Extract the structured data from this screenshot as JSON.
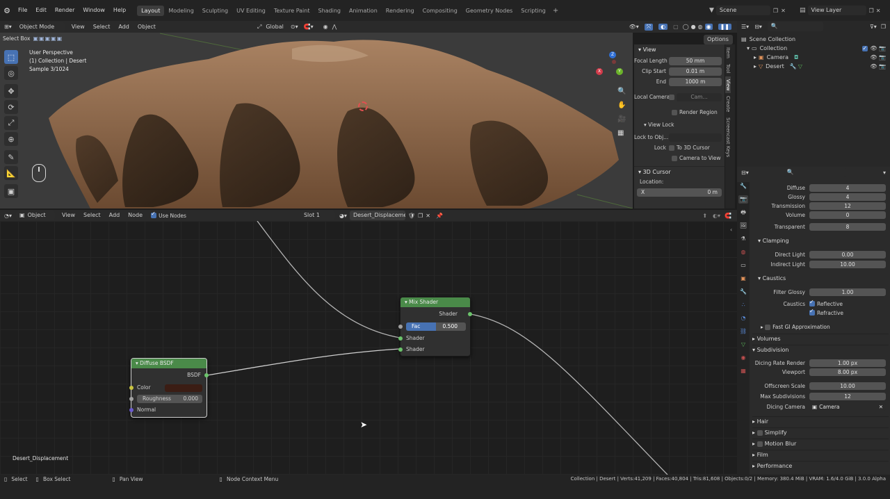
{
  "menu": {
    "items": [
      "File",
      "Edit",
      "Render",
      "Window",
      "Help"
    ],
    "workspaces": [
      "Layout",
      "Modeling",
      "Sculpting",
      "UV Editing",
      "Texture Paint",
      "Shading",
      "Animation",
      "Rendering",
      "Compositing",
      "Geometry Nodes",
      "Scripting"
    ],
    "active_workspace": "Layout",
    "add_tab": "+",
    "scene": "Scene",
    "view_layer": "View Layer"
  },
  "viewport": {
    "mode": "Object Mode",
    "menus": [
      "View",
      "Select",
      "Add",
      "Object"
    ],
    "transform": "Global",
    "options": "Options",
    "select_box": "Select Box",
    "overlay_lines": [
      "User Perspective",
      "(1) Collection | Desert",
      "Sample 3/1024"
    ],
    "gizmo": {
      "x": "X",
      "y": "Y",
      "z": "Z"
    }
  },
  "npanel": {
    "section_view": "View",
    "focal_length_label": "Focal Length",
    "focal_length": "50 mm",
    "clip_start_label": "Clip Start",
    "clip_start": "0.01 m",
    "end_label": "End",
    "end": "1000 m",
    "local_camera_label": "Local Camera",
    "local_camera_value": "Cam...",
    "render_region": "Render Region",
    "view_lock": "View Lock",
    "lock_to_obj_label": "Lock to Obj...",
    "lock_label": "Lock",
    "to_3d_cursor": "To 3D Cursor",
    "camera_to_view": "Camera to View",
    "section_3d_cursor": "3D Cursor",
    "location_label": "Location:",
    "x_label": "X",
    "x_value": "0 m",
    "tabs": [
      "Item",
      "Tool",
      "View",
      "Create",
      "Screencast Keys"
    ],
    "active_tab": "View"
  },
  "outliner": {
    "scene_collection": "Scene Collection",
    "collection": "Collection",
    "items": [
      "Camera",
      "Desert"
    ]
  },
  "properties": {
    "rows_top": [
      {
        "label": "Diffuse",
        "value": "4"
      },
      {
        "label": "Glossy",
        "value": "4"
      },
      {
        "label": "Transmission",
        "value": "12"
      },
      {
        "label": "Volume",
        "value": "0"
      },
      {
        "label": "Transparent",
        "value": "8"
      }
    ],
    "clamping": "Clamping",
    "direct_light_label": "Direct Light",
    "direct_light": "0.00",
    "indirect_light_label": "Indirect Light",
    "indirect_light": "10.00",
    "caustics_section": "Caustics",
    "filter_glossy_label": "Filter Glossy",
    "filter_glossy": "1.00",
    "caustics_label": "Caustics",
    "reflective": "Reflective",
    "refractive": "Refractive",
    "fast_gi": "Fast GI Approximation",
    "volumes": "Volumes",
    "subdivision": "Subdivision",
    "dicing_rate_label": "Dicing Rate Render",
    "dicing_rate": "1.00 px",
    "viewport_label": "Viewport",
    "viewport_rate": "8.00 px",
    "offscreen_label": "Offscreen Scale",
    "offscreen": "10.00",
    "max_subdiv_label": "Max Subdivisions",
    "max_subdiv": "12",
    "dicing_camera_label": "Dicing Camera",
    "dicing_camera": "Camera",
    "collapsed": [
      "Hair",
      "Simplify",
      "Motion Blur",
      "Film",
      "Performance"
    ]
  },
  "node_editor": {
    "type": "Object",
    "menus": [
      "View",
      "Select",
      "Add",
      "Node"
    ],
    "use_nodes": "Use Nodes",
    "slot": "Slot 1",
    "material": "Desert_Displacement",
    "footer_label": "Desert_Displacement",
    "mix_shader": {
      "title": "Mix Shader",
      "output": "Shader",
      "fac_label": "Fac",
      "fac_value": "0.500",
      "fac": 0.5,
      "in1": "Shader",
      "in2": "Shader"
    },
    "diffuse": {
      "title": "Diffuse BSDF",
      "output": "BSDF",
      "color_label": "Color",
      "roughness_label": "Roughness",
      "roughness": "0.000",
      "normal_label": "Normal"
    }
  },
  "statusbar": {
    "select": "Select",
    "box_select": "Box Select",
    "pan_view": "Pan View",
    "context_menu": "Node Context Menu",
    "stats": "Collection | Desert | Verts:41,209 | Faces:40,804 | Tris:81,608 | Objects:0/2 | Memory: 380.4 MiB | VRAM: 1.6/4.0 GiB | 3.0.0 Alpha"
  }
}
